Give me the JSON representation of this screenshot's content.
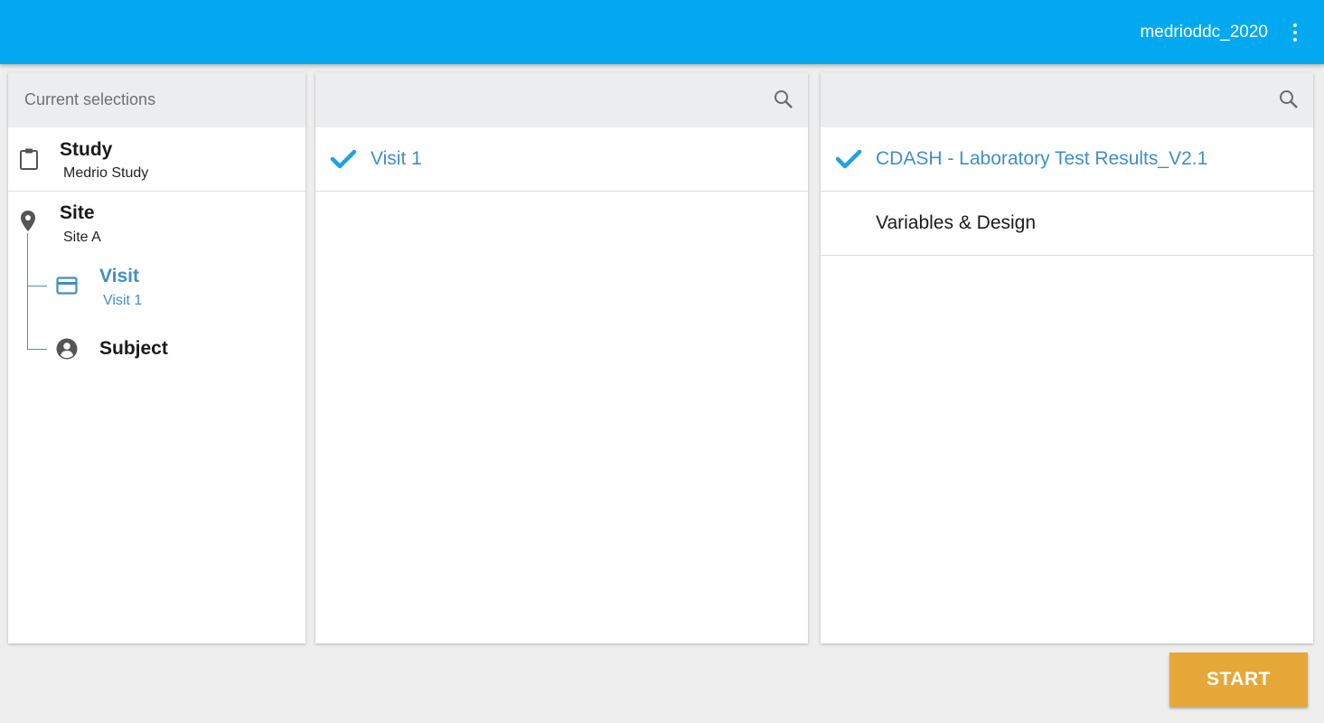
{
  "header": {
    "username": "medrioddc_2020",
    "menu_icon": "more-vert-icon",
    "bg_color": "#03a9f0"
  },
  "selections": {
    "title": "Current selections",
    "items": [
      {
        "label": "Study",
        "value": "Medrio Study",
        "icon": "clipboard-icon"
      },
      {
        "label": "Site",
        "value": "Site A",
        "icon": "location-pin-icon"
      },
      {
        "label": "Visit",
        "value": "Visit 1",
        "icon": "card-icon",
        "active": true
      },
      {
        "label": "Subject",
        "value": "",
        "icon": "account-circle-icon"
      }
    ]
  },
  "visits_panel": {
    "search_icon": "search-icon",
    "items": [
      {
        "label": "Visit 1",
        "selected": true
      }
    ]
  },
  "forms_panel": {
    "search_icon": "search-icon",
    "items": [
      {
        "label": "CDASH - Laboratory Test Results_V2.1",
        "selected": true
      },
      {
        "label": "Variables & Design",
        "selected": false
      }
    ]
  },
  "actions": {
    "start_label": "START",
    "start_color": "#e5a839"
  },
  "colors": {
    "accent_blue": "#3f8ec9",
    "check_blue": "#1ea2e0"
  }
}
